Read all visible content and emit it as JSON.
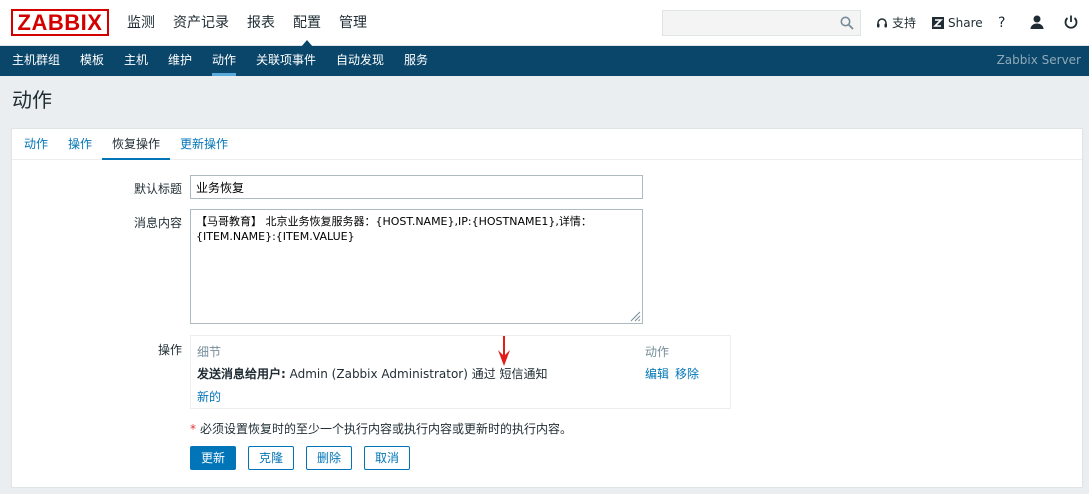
{
  "logo": "ZABBIX",
  "main_nav": [
    "监测",
    "资产记录",
    "报表",
    "配置",
    "管理"
  ],
  "main_nav_active": "配置",
  "search": {
    "value": "",
    "placeholder": ""
  },
  "top_links": {
    "support": "支持",
    "share": "Share",
    "help": "?"
  },
  "sub_nav": [
    "主机群组",
    "模板",
    "主机",
    "维护",
    "动作",
    "关联项事件",
    "自动发现",
    "服务"
  ],
  "sub_nav_active": "动作",
  "server_name": "Zabbix Server",
  "page_title": "动作",
  "tabs": [
    "动作",
    "操作",
    "恢复操作",
    "更新操作"
  ],
  "tab_active": "恢复操作",
  "form": {
    "subject_label": "默认标题",
    "subject_value": "业务恢复",
    "message_label": "消息内容",
    "message_value": "【马哥教育】 北京业务恢复服务器：{HOST.NAME},IP:{HOSTNAME1},详情：{ITEM.NAME}:{ITEM.VALUE}",
    "operations_label": "操作",
    "operations": {
      "col_details": "细节",
      "col_action": "动作",
      "row_bold": "发送消息给用户:",
      "row_text": " Admin (Zabbix Administrator) 通过 短信通知",
      "edit": "编辑",
      "remove": "移除",
      "new": "新的"
    },
    "note": "必须设置恢复时的至少一个执行内容或执行内容或更新时的执行内容。",
    "note_marker": "*"
  },
  "buttons": {
    "update": "更新",
    "clone": "克隆",
    "delete": "删除",
    "cancel": "取消"
  },
  "colors": {
    "brand": "#d40000",
    "nav": "#0a466a",
    "link": "#0275b8"
  },
  "icons": [
    "search-icon",
    "headset-icon",
    "share-icon",
    "user-icon",
    "power-icon",
    "resize-icon",
    "red-arrow-annotation"
  ]
}
